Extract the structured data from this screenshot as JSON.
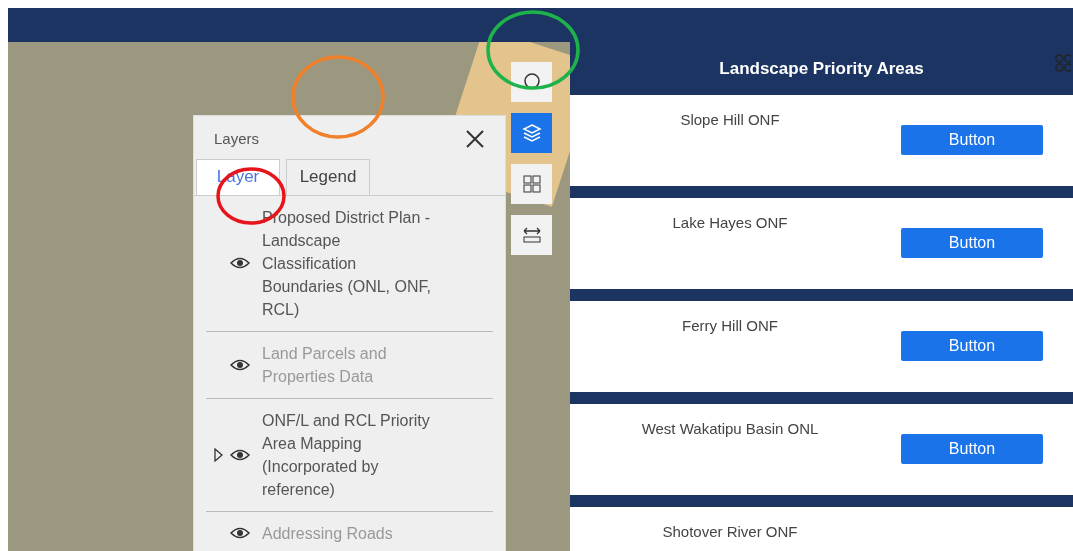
{
  "layers_panel": {
    "title": "Layers",
    "tabs": [
      {
        "label": "Layer",
        "selected": true
      },
      {
        "label": "Legend",
        "selected": false
      }
    ],
    "layers": [
      {
        "name": "Proposed District Plan - Landscape Classification Boundaries (ONL, ONF, RCL)",
        "in_scale_range": true,
        "expandable": false
      },
      {
        "name": "Land Parcels and Properties Data",
        "in_scale_range": false,
        "expandable": false
      },
      {
        "name": "ONF/L and RCL Priority Area Mapping (Incorporated by reference)",
        "in_scale_range": true,
        "expandable": true
      },
      {
        "name": "Addressing Roads",
        "in_scale_range": false,
        "expandable": false
      }
    ]
  },
  "map_tools": [
    {
      "kind": "search",
      "selected": false
    },
    {
      "kind": "layers",
      "selected": true
    },
    {
      "kind": "gallery",
      "selected": false
    },
    {
      "kind": "measure",
      "selected": false
    }
  ],
  "side_panel": {
    "title": "Landscape Priority Areas",
    "items": [
      {
        "name": "Slope Hill ONF",
        "button": "Button"
      },
      {
        "name": "Lake Hayes ONF",
        "button": "Button"
      },
      {
        "name": "Ferry Hill ONF",
        "button": "Button"
      },
      {
        "name": "West Wakatipu Basin ONL",
        "button": "Button"
      },
      {
        "name": "Shotover River ONF"
      }
    ]
  },
  "annotations": [
    {
      "color": "#f0802a"
    },
    {
      "color": "#1db34a"
    },
    {
      "color": "#e8141b"
    }
  ]
}
